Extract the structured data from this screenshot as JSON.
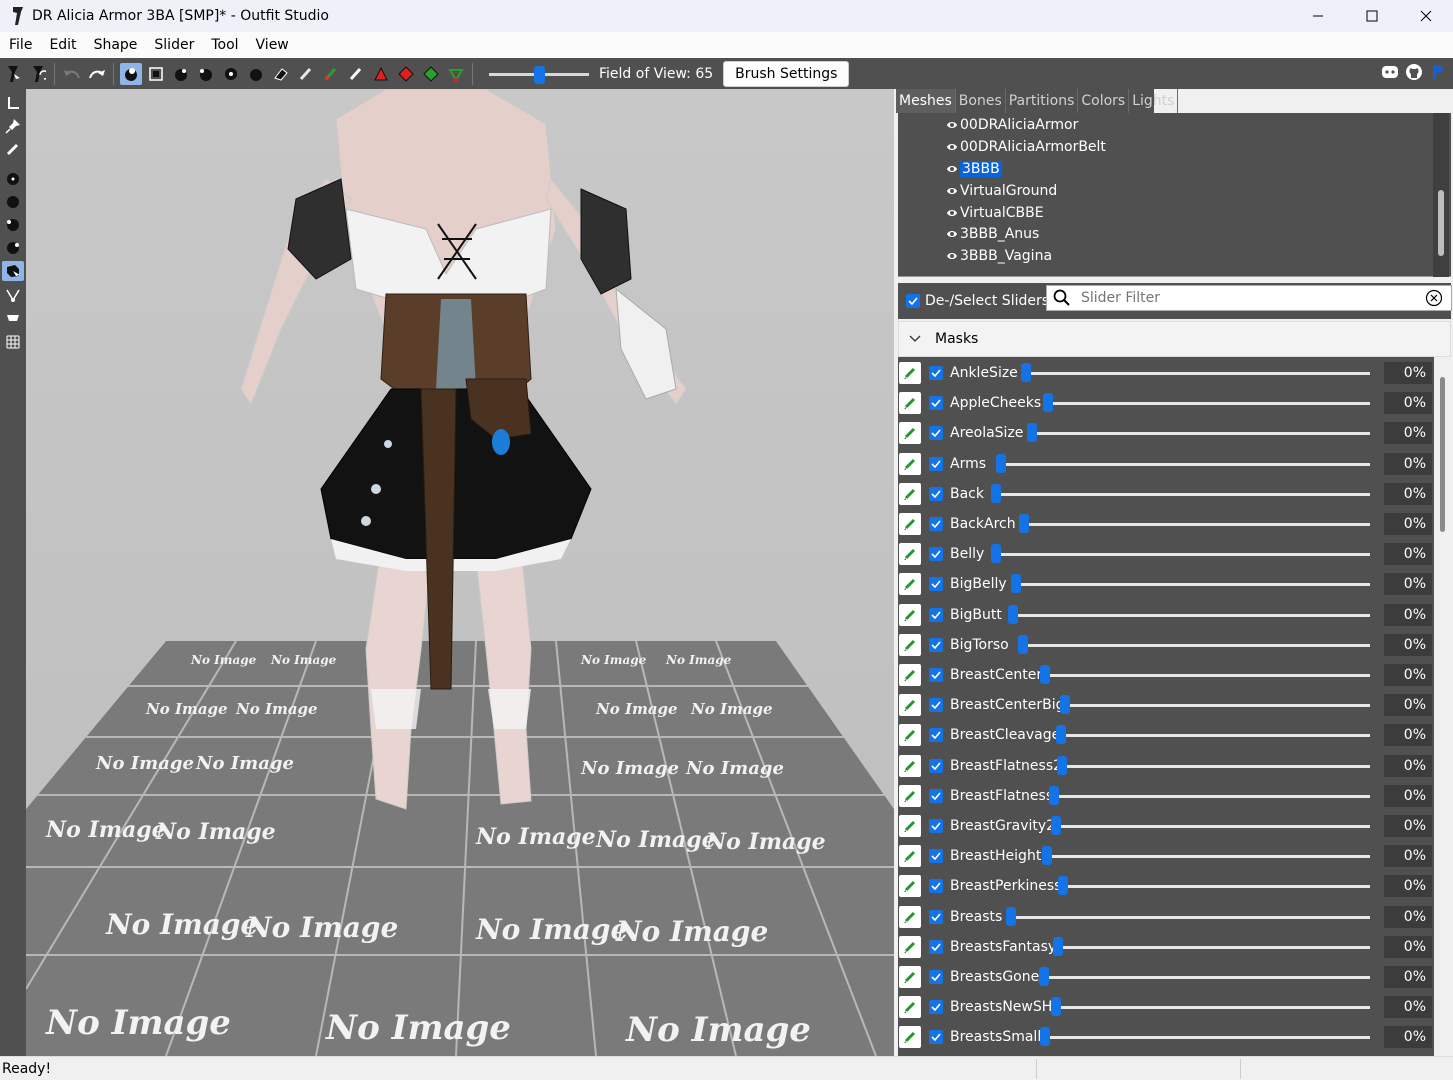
{
  "window": {
    "title": "DR Alicia Armor 3BA [SMP]* - Outfit Studio"
  },
  "menu": [
    "File",
    "Edit",
    "Shape",
    "Slider",
    "Tool",
    "View"
  ],
  "toolbar": {
    "fov_label": "Field of View: 65",
    "fov_value": 65,
    "brush_settings_label": "Brush Settings"
  },
  "tabs": [
    "Meshes",
    "Bones",
    "Partitions",
    "Colors",
    "Lights"
  ],
  "meshes": [
    {
      "name": "00DRAliciaArmor",
      "selected": false
    },
    {
      "name": "00DRAliciaArmorBelt",
      "selected": false
    },
    {
      "name": "3BBB",
      "selected": true
    },
    {
      "name": "VirtualGround",
      "selected": false
    },
    {
      "name": "VirtualCBBE",
      "selected": false
    },
    {
      "name": "3BBB_Anus",
      "selected": false
    },
    {
      "name": "3BBB_Vagina",
      "selected": false
    }
  ],
  "slider_panel": {
    "deselect_label": "De-/Select Sliders",
    "filter_placeholder": "Slider Filter",
    "group_label": "Masks"
  },
  "sliders": [
    {
      "name": "AnkleSize",
      "value": "0%"
    },
    {
      "name": "AppleCheeks",
      "value": "0%"
    },
    {
      "name": "AreolaSize",
      "value": "0%"
    },
    {
      "name": "Arms",
      "value": "0%"
    },
    {
      "name": "Back",
      "value": "0%"
    },
    {
      "name": "BackArch",
      "value": "0%"
    },
    {
      "name": "Belly",
      "value": "0%"
    },
    {
      "name": "BigBelly",
      "value": "0%"
    },
    {
      "name": "BigButt",
      "value": "0%"
    },
    {
      "name": "BigTorso",
      "value": "0%"
    },
    {
      "name": "BreastCenter",
      "value": "0%"
    },
    {
      "name": "BreastCenterBig",
      "value": "0%"
    },
    {
      "name": "BreastCleavage",
      "value": "0%"
    },
    {
      "name": "BreastFlatness2",
      "value": "0%"
    },
    {
      "name": "BreastFlatness",
      "value": "0%"
    },
    {
      "name": "BreastGravity2",
      "value": "0%"
    },
    {
      "name": "BreastHeight",
      "value": "0%"
    },
    {
      "name": "BreastPerkiness",
      "value": "0%"
    },
    {
      "name": "Breasts",
      "value": "0%"
    },
    {
      "name": "BreastsFantasy",
      "value": "0%"
    },
    {
      "name": "BreastsGone",
      "value": "0%"
    },
    {
      "name": "BreastsNewSH",
      "value": "0%"
    },
    {
      "name": "BreastsSmall",
      "value": "0%"
    }
  ],
  "viewport": {
    "ground_texture_text": "No Image"
  },
  "status": {
    "text": "Ready!"
  }
}
